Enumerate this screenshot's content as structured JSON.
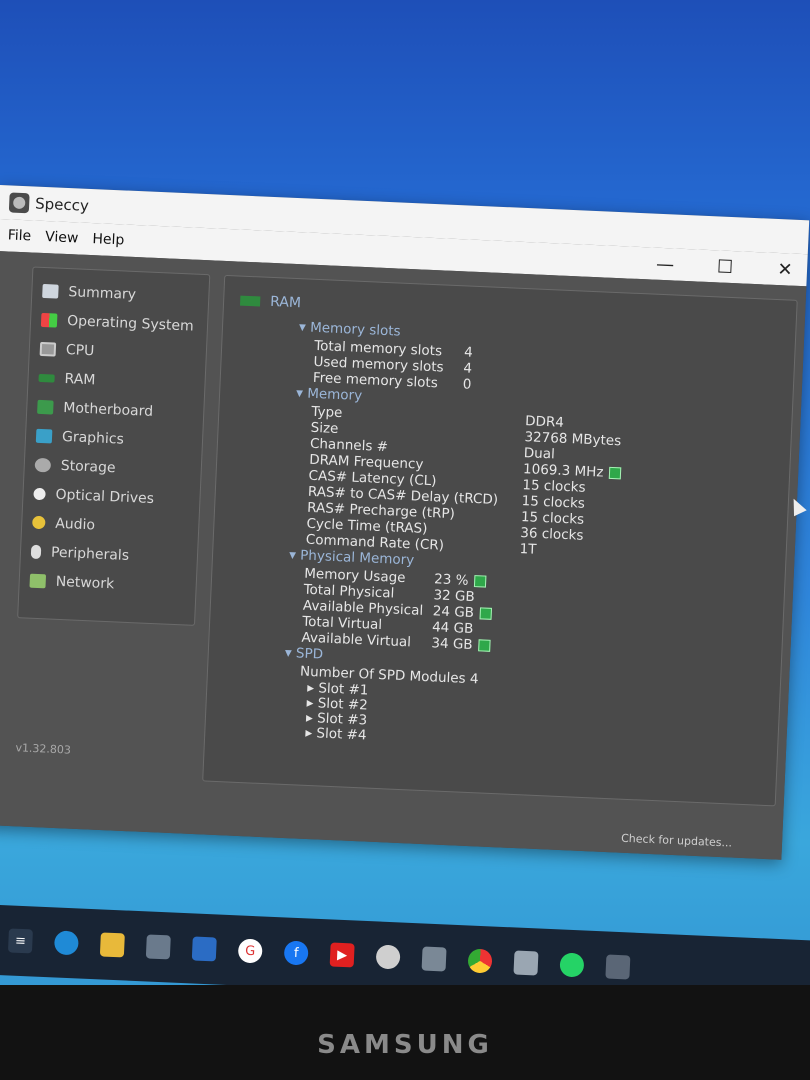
{
  "window": {
    "title": "Speccy",
    "menu": [
      "File",
      "View",
      "Help"
    ],
    "controls": {
      "minimize": "—",
      "maximize": "☐",
      "close": "✕"
    },
    "version": "v1.32.803",
    "check_updates": "Check for updates..."
  },
  "sidebar": {
    "items": [
      {
        "label": "Summary",
        "icon": "summary-icon"
      },
      {
        "label": "Operating System",
        "icon": "windows-icon"
      },
      {
        "label": "CPU",
        "icon": "cpu-icon"
      },
      {
        "label": "RAM",
        "icon": "ram-icon"
      },
      {
        "label": "Motherboard",
        "icon": "motherboard-icon"
      },
      {
        "label": "Graphics",
        "icon": "monitor-icon"
      },
      {
        "label": "Storage",
        "icon": "storage-icon"
      },
      {
        "label": "Optical Drives",
        "icon": "optical-drive-icon"
      },
      {
        "label": "Audio",
        "icon": "audio-icon"
      },
      {
        "label": "Peripherals",
        "icon": "mouse-icon"
      },
      {
        "label": "Network",
        "icon": "network-icon"
      }
    ]
  },
  "content": {
    "heading": "RAM",
    "memory_slots": {
      "title": "Memory slots",
      "rows": [
        {
          "label": "Total memory slots",
          "value": "4"
        },
        {
          "label": "Used memory slots",
          "value": "4"
        },
        {
          "label": "Free memory slots",
          "value": "0"
        }
      ]
    },
    "memory": {
      "title": "Memory",
      "rows": [
        {
          "label": "Type",
          "value": "DDR4"
        },
        {
          "label": "Size",
          "value": "32768 MBytes"
        },
        {
          "label": "Channels #",
          "value": "Dual"
        },
        {
          "label": "DRAM Frequency",
          "value": "1069.3 MHz"
        },
        {
          "label": "CAS# Latency (CL)",
          "value": "15 clocks"
        },
        {
          "label": "RAS# to CAS# Delay (tRCD)",
          "value": "15 clocks"
        },
        {
          "label": "RAS# Precharge (tRP)",
          "value": "15 clocks"
        },
        {
          "label": "Cycle Time (tRAS)",
          "value": "36 clocks"
        },
        {
          "label": "Command Rate (CR)",
          "value": "1T"
        }
      ]
    },
    "physical_memory": {
      "title": "Physical Memory",
      "rows": [
        {
          "label": "Memory Usage",
          "value": "23 %"
        },
        {
          "label": "Total Physical",
          "value": "32 GB"
        },
        {
          "label": "Available Physical",
          "value": "24 GB"
        },
        {
          "label": "Total Virtual",
          "value": "44 GB"
        },
        {
          "label": "Available Virtual",
          "value": "34 GB"
        }
      ]
    },
    "spd": {
      "title": "SPD",
      "modules_label": "Number Of SPD Modules",
      "modules_value": "4",
      "slots": [
        "Slot #1",
        "Slot #2",
        "Slot #3",
        "Slot #4"
      ]
    }
  },
  "monitor_brand": "SAMSUNG"
}
